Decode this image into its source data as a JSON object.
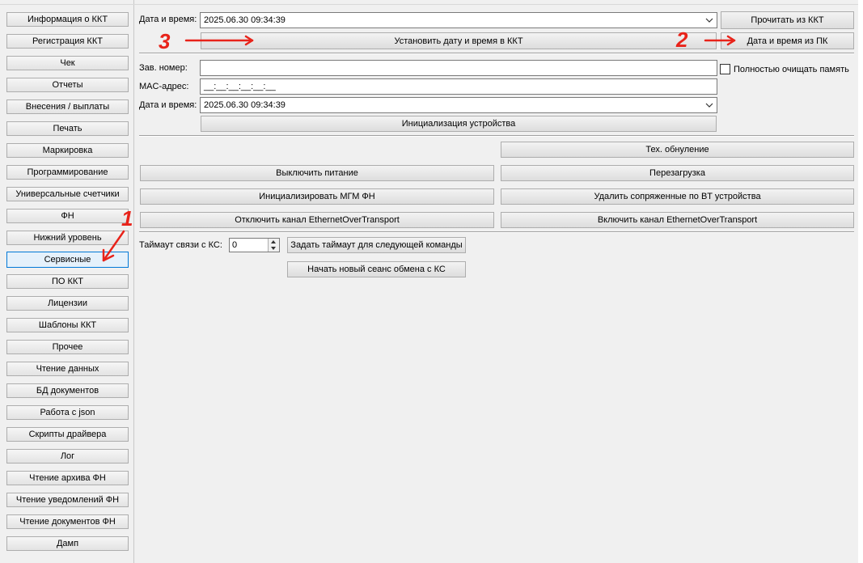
{
  "sidebar": {
    "items": [
      {
        "label": "Информация о ККТ"
      },
      {
        "label": "Регистрация ККТ"
      },
      {
        "label": "Чек"
      },
      {
        "label": "Отчеты"
      },
      {
        "label": "Внесения / выплаты"
      },
      {
        "label": "Печать"
      },
      {
        "label": "Маркировка"
      },
      {
        "label": "Программирование"
      },
      {
        "label": "Универсальные счетчики"
      },
      {
        "label": "ФН"
      },
      {
        "label": "Нижний уровень"
      },
      {
        "label": "Сервисные",
        "active": true
      },
      {
        "label": "ПО ККТ"
      },
      {
        "label": "Лицензии"
      },
      {
        "label": "Шаблоны ККТ"
      },
      {
        "label": "Прочее"
      },
      {
        "label": "Чтение данных"
      },
      {
        "label": "БД документов"
      },
      {
        "label": "Работа с json"
      },
      {
        "label": "Скрипты драйвера"
      },
      {
        "label": "Лог"
      },
      {
        "label": "Чтение архива ФН"
      },
      {
        "label": "Чтение уведомлений ФН"
      },
      {
        "label": "Чтение документов ФН"
      },
      {
        "label": "Дамп"
      }
    ]
  },
  "datetime_section": {
    "label": "Дата и время:",
    "value": "2025.06.30 09:34:39",
    "read_button": "Прочитать из ККТ",
    "set_button": "Установить дату и время в ККТ",
    "pc_button": "Дата и время из ПК"
  },
  "init_section": {
    "serial_label": "Зав. номер:",
    "serial_value": "",
    "clear_memory_label": "Полностью очищать память",
    "clear_memory_checked": false,
    "mac_label": "MAC-адрес:",
    "mac_value": "__:__:__:__:__:__",
    "datetime_label": "Дата и время:",
    "datetime_value": "2025.06.30 09:34:39",
    "init_button": "Инициализация устройства"
  },
  "service_buttons": {
    "tech_reset": "Тех. обнуление",
    "power_off": "Выключить питание",
    "reboot": "Перезагрузка",
    "init_mgm": "Инициализировать МГМ ФН",
    "remove_bt": "Удалить сопряженные по BT устройства",
    "disable_eot": "Отключить канал EthernetOverTransport",
    "enable_eot": "Включить канал EthernetOverTransport"
  },
  "timeout_section": {
    "label": "Таймаут связи с КС:",
    "value": "0",
    "set_button": "Задать таймаут для следующей команды",
    "new_session_button": "Начать новый сеанс обмена с КС"
  },
  "annotations": {
    "step1": "1",
    "step2": "2",
    "step3": "3",
    "color": "#e8231a"
  }
}
